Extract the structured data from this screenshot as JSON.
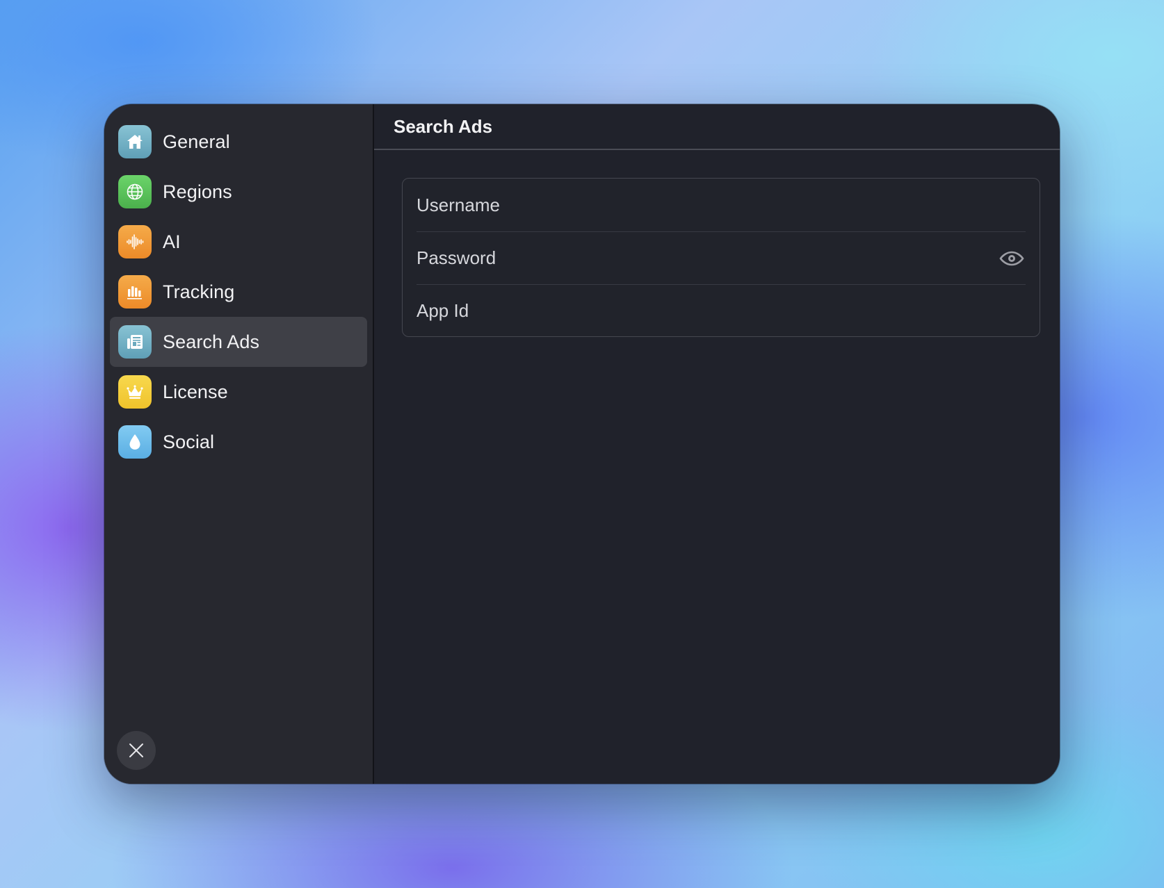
{
  "sidebar": {
    "items": [
      {
        "label": "General",
        "icon": "house-icon",
        "color": "#6fb0c6",
        "active": false
      },
      {
        "label": "Regions",
        "icon": "globe-icon",
        "color": "#5bc35b",
        "active": false
      },
      {
        "label": "AI",
        "icon": "waveform-icon",
        "color": "#f19a36",
        "active": false
      },
      {
        "label": "Tracking",
        "icon": "chart-bars-icon",
        "color": "#f19a36",
        "active": false
      },
      {
        "label": "Search Ads",
        "icon": "newspaper-icon",
        "color": "#6fb0c6",
        "active": true
      },
      {
        "label": "License",
        "icon": "crown-icon",
        "color": "#f5ce3a",
        "active": false
      },
      {
        "label": "Social",
        "icon": "drop-icon",
        "color": "#6cbcec",
        "active": false
      }
    ],
    "close_icon": "close-icon"
  },
  "content": {
    "title": "Search Ads",
    "fields": {
      "username": {
        "placeholder": "Username",
        "value": ""
      },
      "password": {
        "placeholder": "Password",
        "value": ""
      },
      "app_id": {
        "placeholder": "App Id",
        "value": ""
      }
    },
    "password_toggle_icon": "eye-icon"
  }
}
